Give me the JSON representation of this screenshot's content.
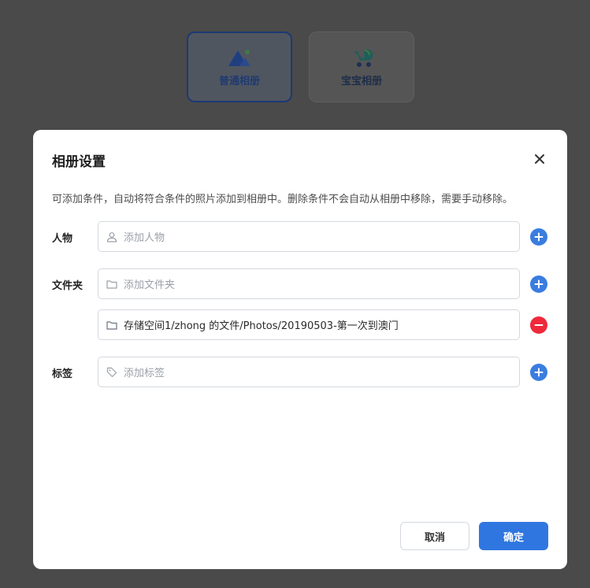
{
  "album_types": [
    {
      "label": "普通相册",
      "icon": "mountain-icon",
      "selected": true
    },
    {
      "label": "宝宝相册",
      "icon": "stroller-icon",
      "selected": false
    }
  ],
  "dialog": {
    "title": "相册设置",
    "description": "可添加条件，自动将符合条件的照片添加到相册中。删除条件不会自动从相册中移除，需要手动移除。",
    "rows": {
      "people": {
        "label": "人物",
        "placeholder": "添加人物"
      },
      "folder": {
        "label": "文件夹",
        "placeholder": "添加文件夹",
        "items": [
          "存储空间1/zhong 的文件/Photos/20190503-第一次到澳门"
        ]
      },
      "tags": {
        "label": "标签",
        "placeholder": "添加标签"
      }
    },
    "buttons": {
      "cancel": "取消",
      "confirm": "确定"
    }
  },
  "colors": {
    "accent": "#2f76e0",
    "add": "#3a7de0",
    "remove": "#f0283c",
    "overlay": "#4a4a4a"
  }
}
